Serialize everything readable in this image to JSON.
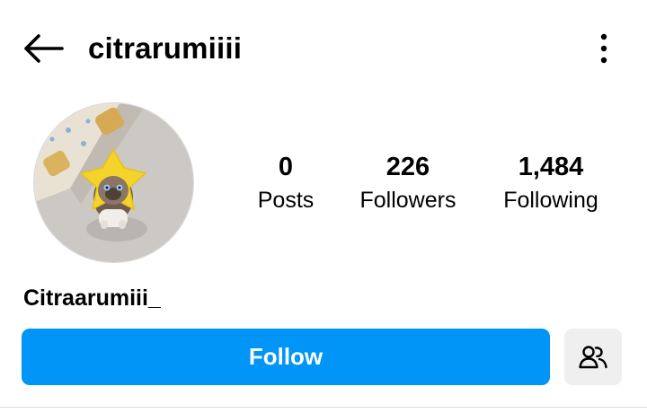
{
  "header": {
    "username": "citrarumiiii"
  },
  "profile": {
    "display_name": "Citraarumiii_",
    "avatar_description": "avatar-photo"
  },
  "stats": [
    {
      "value": "0",
      "label": "Posts"
    },
    {
      "value": "226",
      "label": "Followers"
    },
    {
      "value": "1,484",
      "label": "Following"
    }
  ],
  "actions": {
    "follow_label": "Follow",
    "suggest_icon": "add-people-icon"
  },
  "icons": {
    "back": "arrow-left-icon",
    "more": "vertical-dots-icon"
  },
  "colors": {
    "accent": "#0095f6",
    "secondary_button": "#efefef"
  }
}
